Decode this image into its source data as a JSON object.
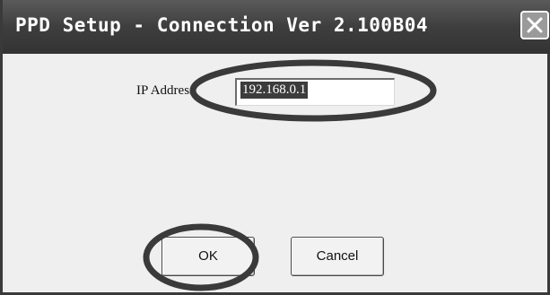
{
  "window": {
    "title": "PPD Setup - Connection  Ver 2.100B04",
    "close_icon": "close-icon"
  },
  "form": {
    "ip_label": "IP Address",
    "ip_value": "192.168.0.1"
  },
  "buttons": {
    "ok_label": "OK",
    "cancel_label": "Cancel"
  },
  "colors": {
    "titlebar": "#3e3e3e",
    "highlight_ellipse": "#3a3a3a",
    "selection": "#3c3c3c"
  }
}
